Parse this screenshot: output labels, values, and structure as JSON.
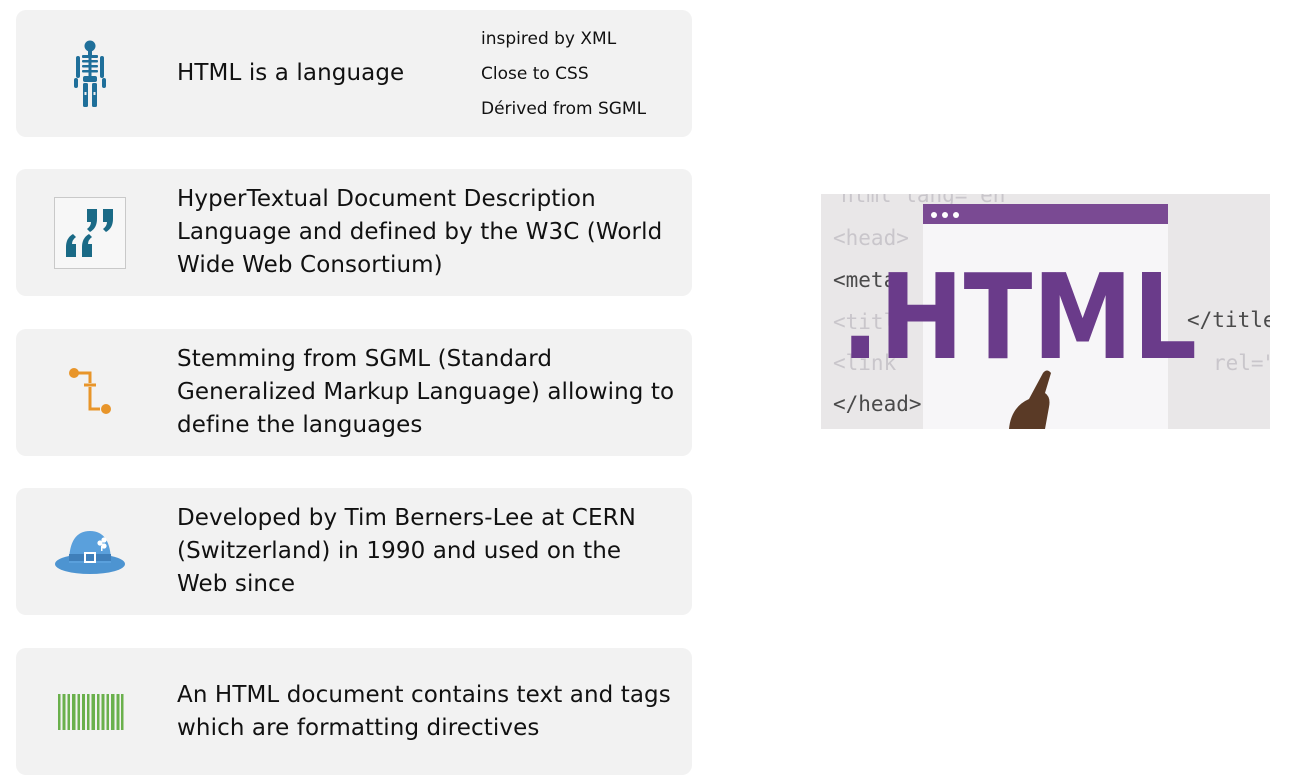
{
  "cards": [
    {
      "icon": "skeleton-icon",
      "text": "HTML is a language",
      "side_notes": [
        "inspired by XML",
        "Close to CSS",
        "Dérived from SGML"
      ]
    },
    {
      "icon": "quote-icon",
      "text": "HyperTextual Document Description Language and defined by the W3C (World Wide Web Consortium)"
    },
    {
      "icon": "flow-steps-icon",
      "text": "Stemming from SGML (Standard Generalized Markup Language) allowing to define the languages"
    },
    {
      "icon": "hat-icon",
      "text": "Developed by Tim Berners-Lee at CERN (Switzerland) in 1990 and used on the Web since"
    },
    {
      "icon": "barcode-icon",
      "text": "An HTML document contains text and tags which are formatting directives"
    }
  ],
  "html_image": {
    "big_text": ".HTML",
    "code_lines": [
      "html lang=\"en\"",
      "<head>",
      "<meta",
      "<title",
      "<link",
      "</head>",
      "</title",
      "rel=\""
    ]
  },
  "colors": {
    "card_bg": "#f2f2f2",
    "skeleton": "#1f6f9a",
    "quote": "#1a6a86",
    "flow": "#e8952a",
    "hat": "#4d94d1",
    "barcode": "#6ab04c",
    "html_purple": "#6a3b8a"
  }
}
